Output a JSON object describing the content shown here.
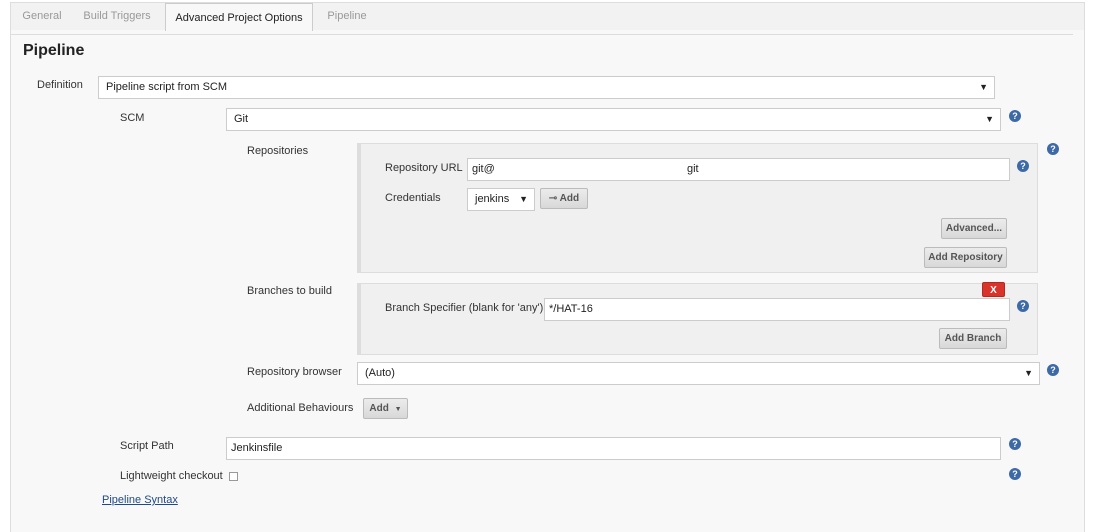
{
  "tabs": [
    {
      "label": "General",
      "active": false
    },
    {
      "label": "Build Triggers",
      "active": false
    },
    {
      "label": "Advanced Project Options",
      "active": true
    },
    {
      "label": "Pipeline",
      "active": false
    }
  ],
  "section_title": "Pipeline",
  "definition": {
    "label": "Definition",
    "value": "Pipeline script from SCM"
  },
  "scm": {
    "label": "SCM",
    "value": "Git"
  },
  "repositories": {
    "label": "Repositories",
    "url_label": "Repository URL",
    "url_value": "git@",
    "url_suffix": "git",
    "credentials_label": "Credentials",
    "credentials_value": "jenkins",
    "add_label": "Add",
    "advanced_label": "Advanced...",
    "add_repository_label": "Add Repository"
  },
  "branches": {
    "label": "Branches to build",
    "delete_label": "X",
    "specifier_label": "Branch Specifier (blank for 'any')",
    "specifier_value": "*/HAT-16",
    "add_branch_label": "Add Branch"
  },
  "repo_browser": {
    "label": "Repository browser",
    "value": "(Auto)"
  },
  "additional_behaviours": {
    "label": "Additional Behaviours",
    "add_label": "Add"
  },
  "script_path": {
    "label": "Script Path",
    "value": "Jenkinsfile"
  },
  "lightweight_checkout": {
    "label": "Lightweight checkout",
    "checked": false
  },
  "pipeline_syntax_link": "Pipeline Syntax",
  "help_glyph": "?",
  "dropdown_glyph": "▼",
  "colors": {
    "help": "#3d6aa6",
    "delete": "#d9342b",
    "link": "#204a87"
  }
}
